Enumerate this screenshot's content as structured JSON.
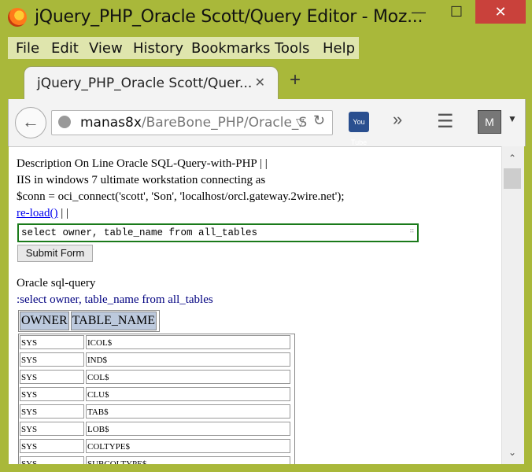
{
  "window": {
    "title": "jQuery_PHP_Oracle Scott/Query Editor - Moz...",
    "min_glyph": "—",
    "max_glyph": "☐",
    "close_glyph": "✕"
  },
  "menu": [
    "File",
    "Edit",
    "View",
    "History",
    "Bookmarks",
    "Tools",
    "Help"
  ],
  "tab": {
    "label": "jQuery_PHP_Oracle Scott/Quer...",
    "close_glyph": "✕",
    "newtab_glyph": "+"
  },
  "nav": {
    "back_glyph": "←",
    "url_host": "manas8x",
    "url_path": "/BareBone_PHP/Oracle_S",
    "url_drop_glyph": "▽",
    "reload_glyph": "↻",
    "youtube_label": "You Tube",
    "overflow_glyph": "»",
    "menu_glyph": "☰",
    "mcafee_label": "M",
    "mcafee_drop_glyph": "▼"
  },
  "page": {
    "description_line": "Description On Line Oracle SQL-Query-with-PHP  | |",
    "iis_line": "IIS in windows 7 ultimate workstation connecting as",
    "conn_line": "$conn = oci_connect('scott', 'Son', 'localhost/orcl.gateway.2wire.net');",
    "reload_link": "re-load()",
    "reload_suffix": "| |",
    "query_value": "select owner, table_name from all_tables",
    "submit_label": "Submit Form",
    "result_title": "Oracle sql-query",
    "echo_query": ":select owner, table_name from all_tables",
    "columns": [
      "OWNER",
      "TABLE_NAME"
    ],
    "rows": [
      [
        "SYS",
        "ICOL$"
      ],
      [
        "SYS",
        "IND$"
      ],
      [
        "SYS",
        "COL$"
      ],
      [
        "SYS",
        "CLU$"
      ],
      [
        "SYS",
        "TAB$"
      ],
      [
        "SYS",
        "LOB$"
      ],
      [
        "SYS",
        "COLTYPE$"
      ],
      [
        "SYS",
        "SUBCOLTYPE$"
      ]
    ]
  },
  "scrollbar": {
    "up_glyph": "⌃",
    "down_glyph": "⌄"
  },
  "colors": {
    "window_frame": "#a9b83a",
    "close_button": "#c9413b",
    "input_border": "#1a7a1a",
    "header_cell": "#bcc9dd",
    "link": "#0000ee"
  }
}
